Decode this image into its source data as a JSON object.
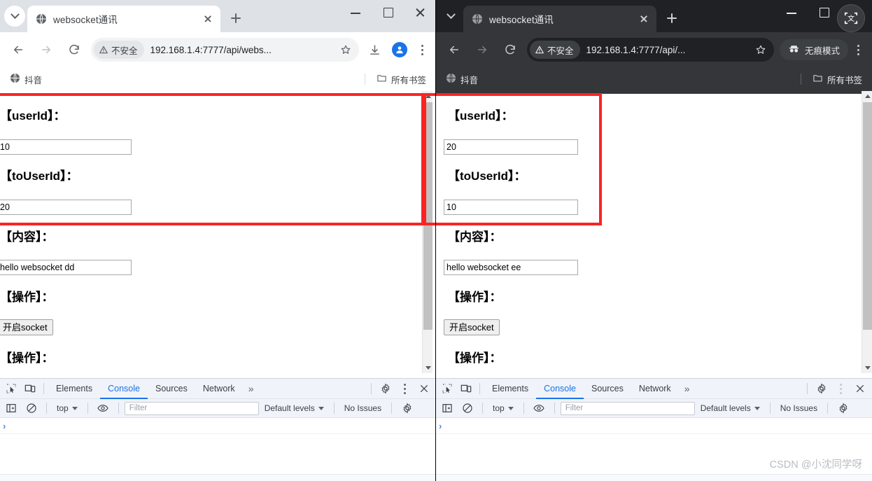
{
  "left_window": {
    "theme": "light",
    "tab": {
      "title": "websocket通讯",
      "favicon": "globe-icon",
      "close": "close-icon"
    },
    "new_tab_label": "+",
    "nav": {
      "back": "back-arrow-icon",
      "forward": "forward-arrow-icon",
      "reload": "reload-icon",
      "security_label": "不安全",
      "url": "192.168.1.4:7777/api/webs...",
      "bookmark_star": "star-icon",
      "download": "download-icon",
      "profile": "avatar-icon",
      "menu": "kebab-menu-icon"
    },
    "bookmarks": {
      "items": [
        {
          "label": "抖音",
          "icon": "globe-icon"
        }
      ],
      "all_bookmarks_label": "所有书签",
      "all_bookmarks_icon": "folder-icon"
    },
    "page": {
      "fields": [
        {
          "label": "【userId】：",
          "value": "10"
        },
        {
          "label": "【toUserId】：",
          "value": "20"
        },
        {
          "label": "【内容】：",
          "value": "hello websocket dd"
        }
      ],
      "action_label_1": "【操作】：",
      "socket_button": "开启socket",
      "action_label_2": "【操作】："
    },
    "devtools": {
      "tabs": [
        "Elements",
        "Console",
        "Sources",
        "Network"
      ],
      "active_tab": "Console",
      "more_tabs": "»",
      "context": "top",
      "filter_placeholder": "Filter",
      "levels": "Default levels",
      "issues": "No Issues",
      "prompt": "›"
    }
  },
  "right_window": {
    "theme": "dark-incognito",
    "tab": {
      "title": "websocket通讯",
      "favicon": "globe-icon",
      "close": "close-icon"
    },
    "new_tab_label": "+",
    "ocr_badge_icon": "translate-capture-icon",
    "nav": {
      "back": "back-arrow-icon",
      "forward": "forward-arrow-icon",
      "reload": "reload-icon",
      "security_label": "不安全",
      "url": "192.168.1.4:7777/api/...",
      "bookmark_star": "star-icon",
      "incognito_label": "无痕模式",
      "incognito_icon": "incognito-spy-icon",
      "menu": "kebab-menu-icon"
    },
    "bookmarks": {
      "items": [
        {
          "label": "抖音",
          "icon": "globe-icon"
        }
      ],
      "all_bookmarks_label": "所有书签",
      "all_bookmarks_icon": "folder-icon"
    },
    "page": {
      "fields": [
        {
          "label": "【userId】：",
          "value": "20"
        },
        {
          "label": "【toUserId】：",
          "value": "10"
        },
        {
          "label": "【内容】：",
          "value": "hello websocket ee"
        }
      ],
      "action_label_1": "【操作】：",
      "socket_button": "开启socket",
      "action_label_2": "【操作】："
    },
    "devtools": {
      "tabs": [
        "Elements",
        "Console",
        "Sources",
        "Network"
      ],
      "active_tab": "Console",
      "more_tabs": "»",
      "context": "top",
      "filter_placeholder": "Filter",
      "levels": "Default levels",
      "issues": "No Issues",
      "prompt": "›"
    }
  },
  "annotation": {
    "highlight_color": "#fb2323",
    "note": "red-rectangles-around-userid-and-touserid"
  },
  "watermark": "CSDN @小沈同学呀"
}
